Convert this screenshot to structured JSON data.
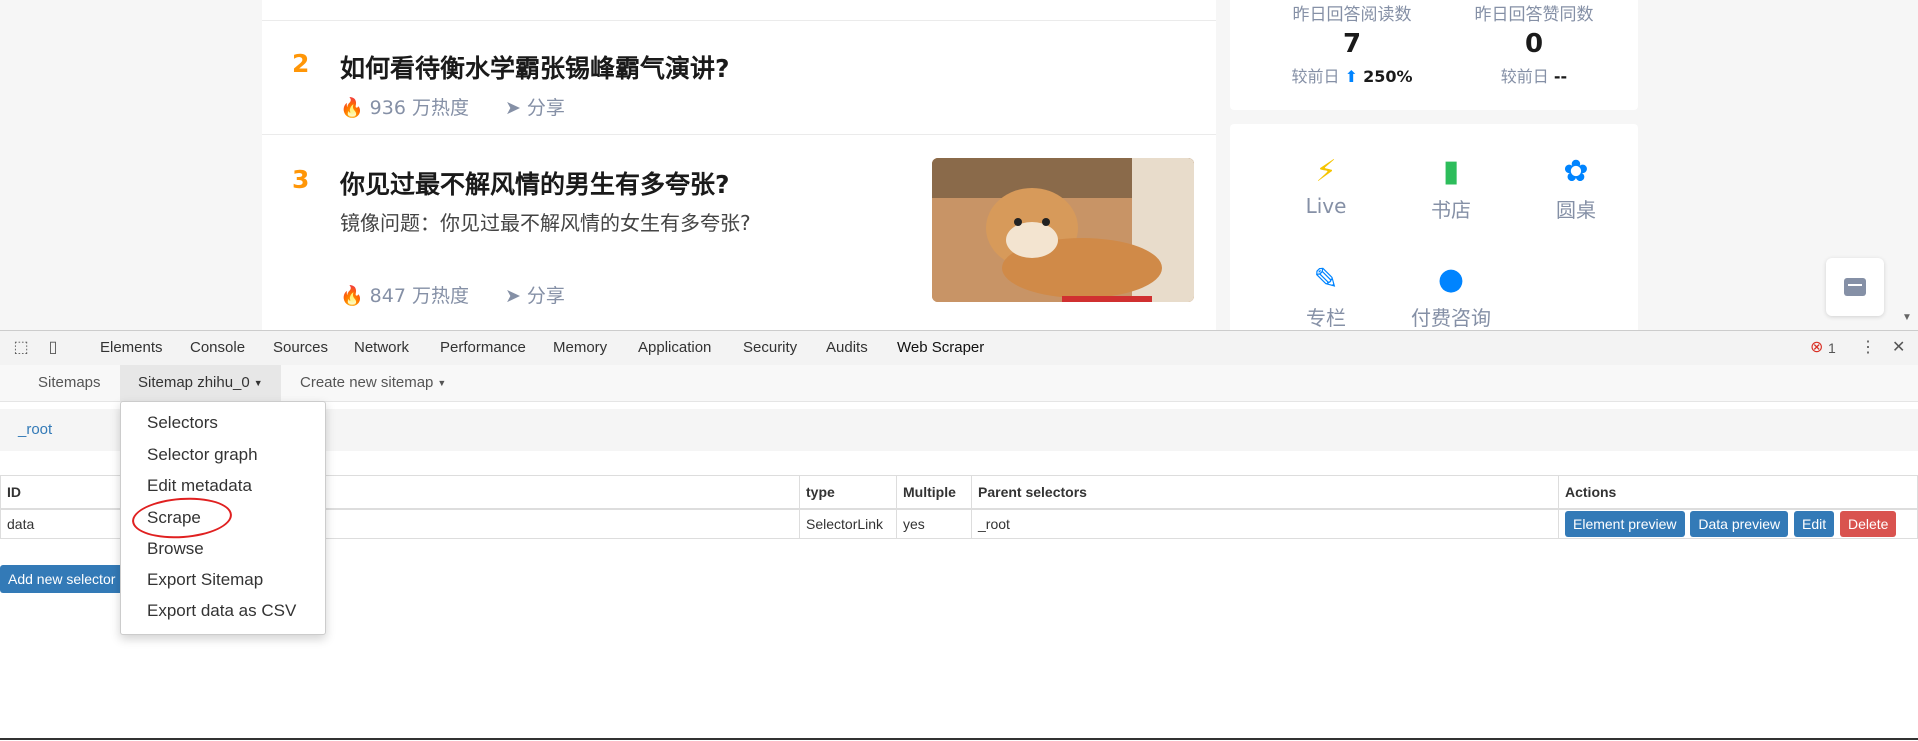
{
  "feed": {
    "items": [
      {
        "rank": "2",
        "title": "如何看待衡水学霸张锡峰霸气演讲?",
        "heat": "936 万热度",
        "share": "分享"
      },
      {
        "rank": "3",
        "title": "你见过最不解风情的男生有多夸张?",
        "subtitle": "镜像问题：你见过最不解风情的女生有多夸张?",
        "heat": "847 万热度",
        "share": "分享"
      }
    ]
  },
  "stats": [
    {
      "label": "昨日回答阅读数",
      "value": "7",
      "compare_label": "较前日",
      "compare_value": "250%"
    },
    {
      "label": "昨日回答赞同数",
      "value": "0",
      "compare_label": "较前日",
      "compare_value": "--"
    }
  ],
  "tools": [
    {
      "label": "Live",
      "icon": "lightning-icon",
      "color": "#f5c400"
    },
    {
      "label": "书店",
      "icon": "book-icon",
      "color": "#2dbd5b"
    },
    {
      "label": "圆桌",
      "icon": "flower-icon",
      "color": "#0084ff"
    },
    {
      "label": "专栏",
      "icon": "pen-icon",
      "color": "#0084ff"
    },
    {
      "label": "付费咨询",
      "icon": "consult-icon",
      "color": "#0084ff"
    }
  ],
  "devtools": {
    "tabs": [
      "Elements",
      "Console",
      "Sources",
      "Network",
      "Performance",
      "Memory",
      "Application",
      "Security",
      "Audits",
      "Web Scraper"
    ],
    "active_tab": "Web Scraper",
    "error_count": "1"
  },
  "webscraper": {
    "nav": {
      "sitemaps": "Sitemaps",
      "sitemap": "Sitemap zhihu_0",
      "create": "Create new sitemap"
    },
    "breadcrumb": "_root",
    "table": {
      "headers": [
        "ID",
        "type",
        "Multiple",
        "Parent selectors",
        "Actions"
      ],
      "rows": [
        {
          "id": "data",
          "type": "SelectorLink",
          "multiple": "yes",
          "parent": "_root"
        }
      ],
      "actions": [
        "Element preview",
        "Data preview",
        "Edit",
        "Delete"
      ]
    },
    "add_button": "Add new selector",
    "dropdown": [
      "Selectors",
      "Selector graph",
      "Edit metadata",
      "Scrape",
      "Browse",
      "Export Sitemap",
      "Export data as CSV"
    ]
  },
  "colors": {
    "accent": "#337ab7",
    "danger": "#d9534f",
    "rank": "#ff9607",
    "zhihu_blue": "#0084ff"
  }
}
